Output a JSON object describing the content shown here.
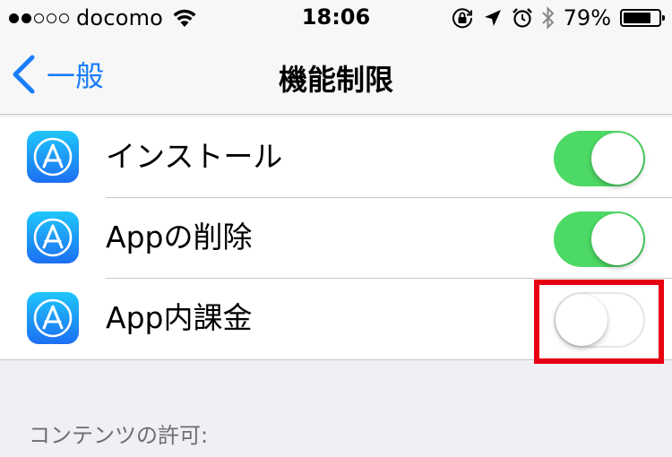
{
  "status_bar": {
    "signal_full_dots": 2,
    "signal_empty_dots": 3,
    "carrier": "docomo",
    "time": "18:06",
    "battery_percent": "79%",
    "battery_level": 0.79
  },
  "nav": {
    "back_label": "一般",
    "title": "機能制限"
  },
  "rows": [
    {
      "label": "インストール",
      "toggle": "on"
    },
    {
      "label": "Appの削除",
      "toggle": "on"
    },
    {
      "label": "App内課金",
      "toggle": "off"
    }
  ],
  "section_header": "コンテンツの許可:",
  "colors": {
    "accent": "#1a7dfa",
    "toggle_on": "#4cd964",
    "highlight": "#e60012",
    "background": "#efeff4"
  },
  "icons": {
    "row_icon": "app-store-icon"
  }
}
